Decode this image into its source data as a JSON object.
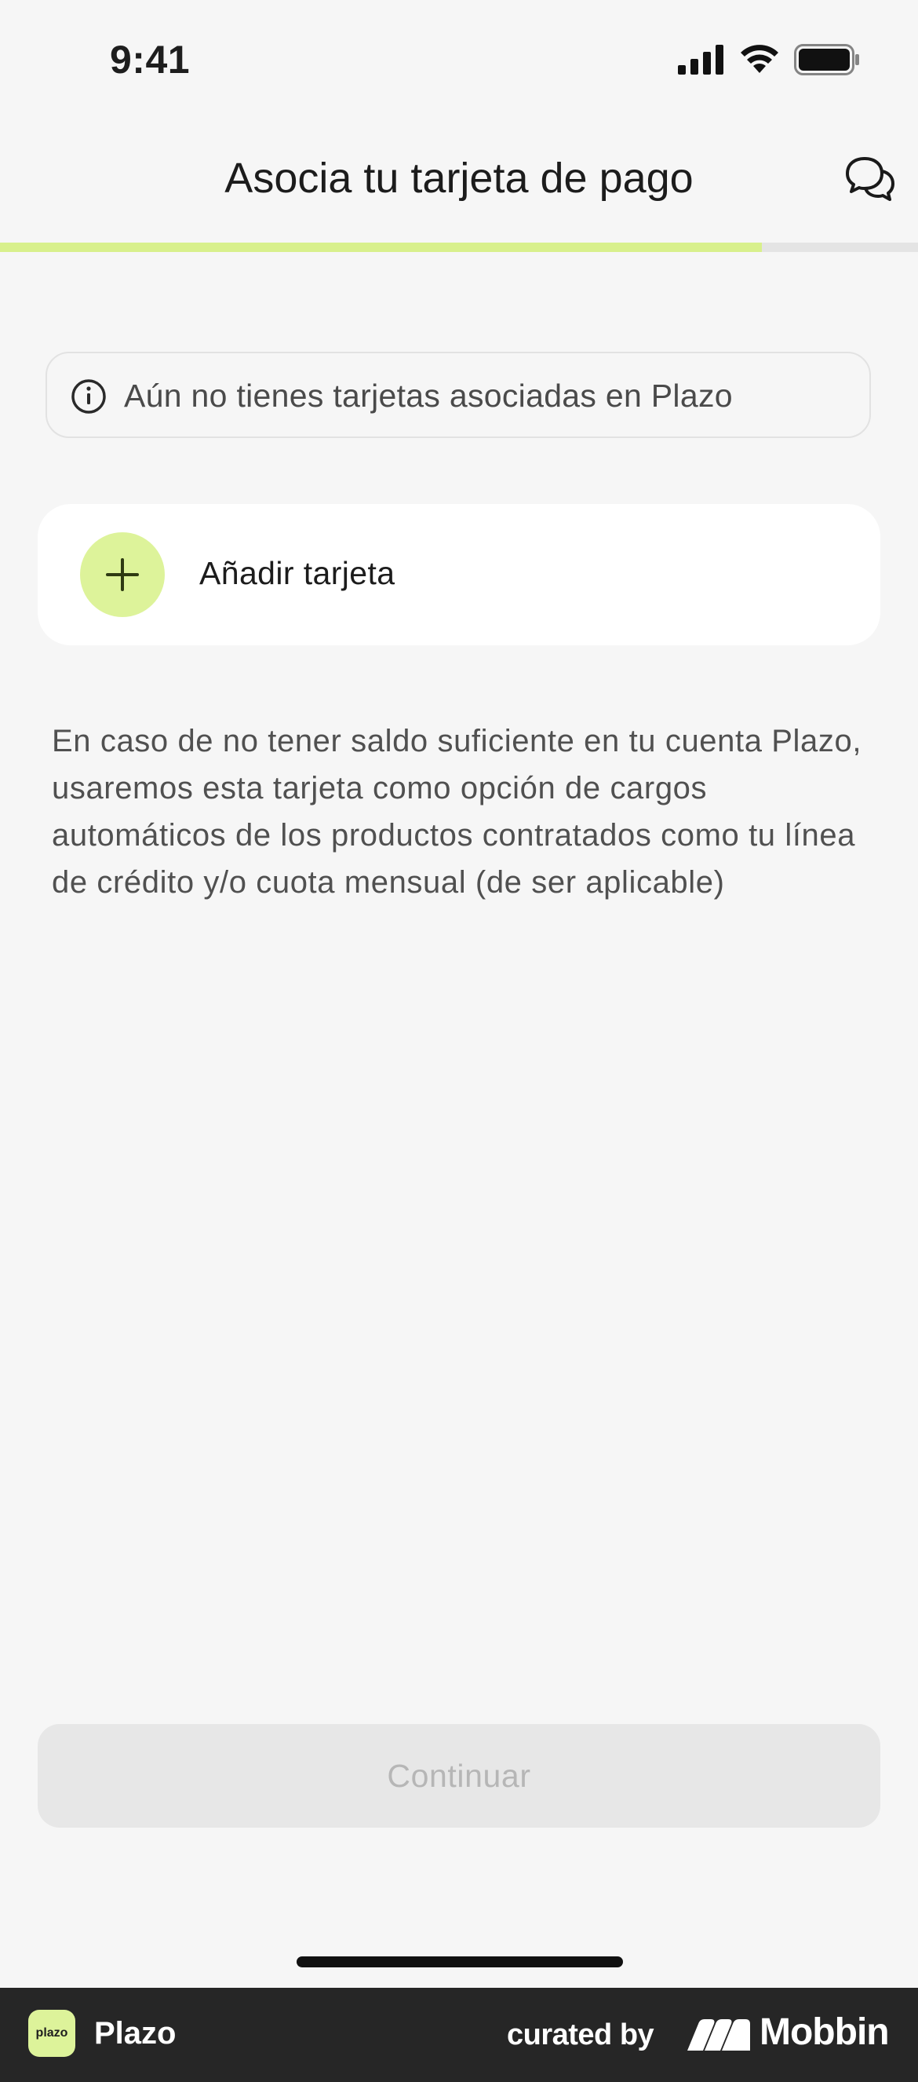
{
  "status_bar": {
    "time": "9:41"
  },
  "header": {
    "title": "Asocia tu tarjeta de pago"
  },
  "progress": {
    "fraction": 0.83,
    "fill_color": "#d8f08c"
  },
  "info_banner": {
    "text": "Aún no tienes tarjetas asociadas en Plazo"
  },
  "add_card": {
    "label": "Añadir tarjeta",
    "accent": "#ddf39a"
  },
  "description": "En caso de no tener saldo suficiente en tu cuenta Plazo, usaremos esta tarjeta como opción de cargos automáticos de los productos contratados como tu línea de crédito y/o cuota mensual (de ser aplicable)",
  "continue_button": {
    "label": "Continuar",
    "state": "disabled"
  },
  "footer": {
    "app_logo_text": "plazo",
    "app_name": "Plazo",
    "curated_by": "curated by",
    "brand": "Mobbin"
  }
}
